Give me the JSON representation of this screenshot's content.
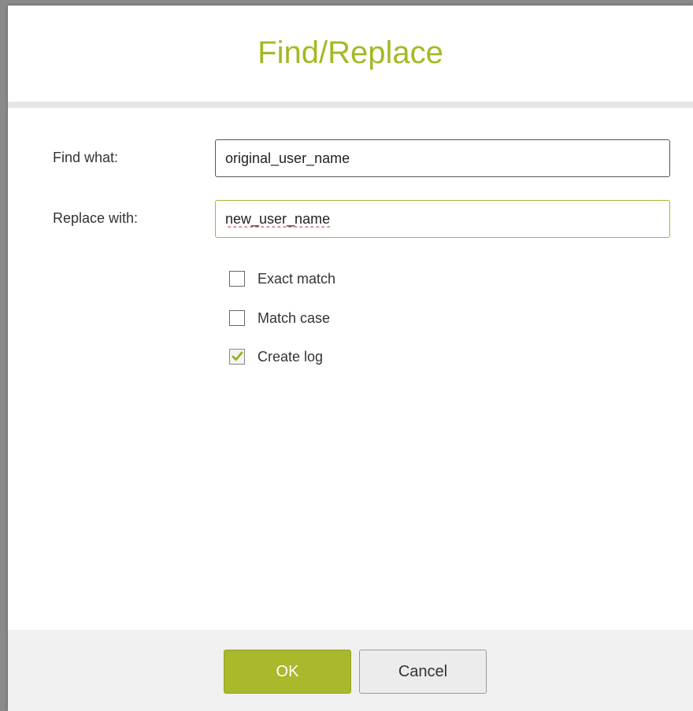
{
  "dialog": {
    "title": "Find/Replace",
    "accent_color": "#a6b825"
  },
  "find": {
    "label": "Find what:",
    "value": "original_user_name"
  },
  "replace": {
    "label": "Replace with:",
    "value": "new_user_name"
  },
  "options": [
    {
      "label": "Exact match",
      "checked": false
    },
    {
      "label": "Match case",
      "checked": false
    },
    {
      "label": "Create log",
      "checked": true
    }
  ],
  "buttons": {
    "ok_label": "OK",
    "cancel_label": "Cancel"
  }
}
